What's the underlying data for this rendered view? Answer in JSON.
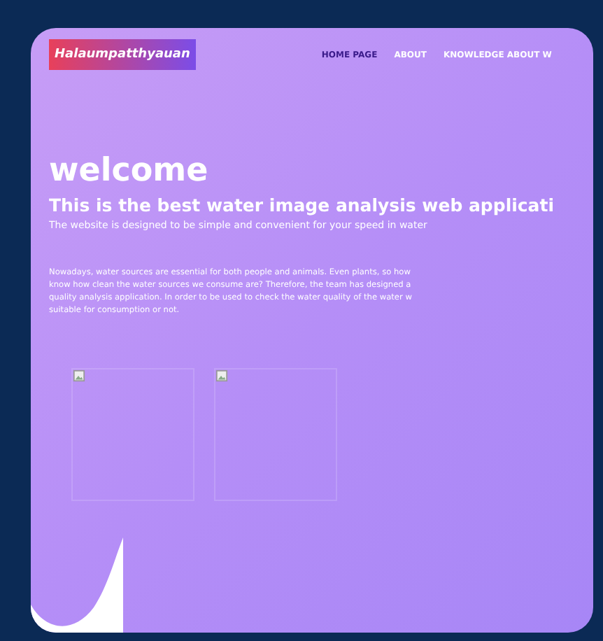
{
  "header": {
    "logo": "Halaumpatthyauan",
    "nav": [
      {
        "label": "HOME PAGE",
        "selected": true
      },
      {
        "label": "ABOUT",
        "selected": false
      },
      {
        "label": "KNOWLEDGE ABOUT W",
        "selected": false
      }
    ]
  },
  "hero": {
    "title": "welcome",
    "subtitle": "This is the best water image analysis web applicati",
    "tagline": "The website is designed to be simple and convenient for your speed in water",
    "paragraph": [
      "Nowadays, water sources are essential for both people and animals. Even plants, so how",
      "know how clean the water sources we consume are? Therefore, the team has designed a",
      "quality analysis application. In order to be used to check the water quality of the water w",
      "suitable for consumption or not."
    ]
  },
  "images": [
    {
      "kind": "broken"
    },
    {
      "kind": "broken"
    }
  ]
}
